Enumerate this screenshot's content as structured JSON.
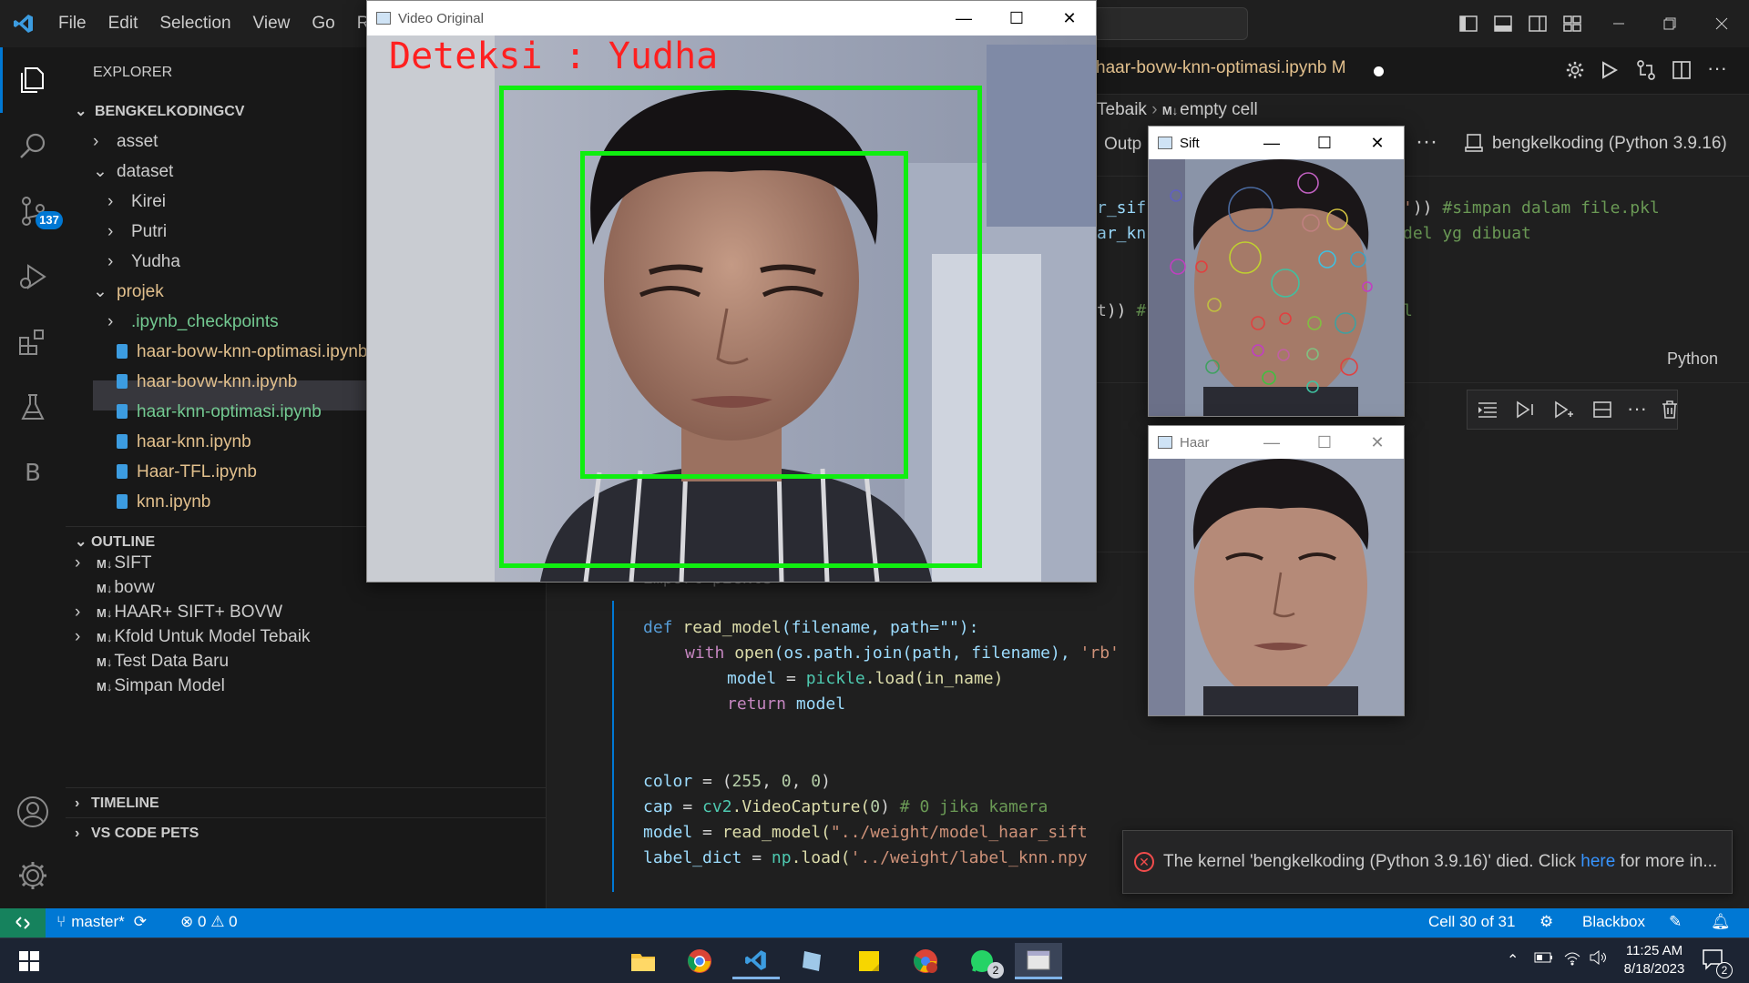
{
  "menu": [
    "File",
    "Edit",
    "Selection",
    "View",
    "Go",
    "R"
  ],
  "explorer": {
    "title": "EXPLORER",
    "root": "BENGKELKODINGCV",
    "items": [
      {
        "label": "asset",
        "type": "folder",
        "collapsed": true,
        "level": 1
      },
      {
        "label": "dataset",
        "type": "folder",
        "collapsed": false,
        "level": 1
      },
      {
        "label": "Kirei",
        "type": "folder",
        "collapsed": true,
        "level": 2
      },
      {
        "label": "Putri",
        "type": "folder",
        "collapsed": true,
        "level": 2
      },
      {
        "label": "Yudha",
        "type": "folder",
        "collapsed": true,
        "level": 2
      },
      {
        "label": "projek",
        "type": "folder",
        "collapsed": false,
        "level": 1,
        "status": "mod"
      },
      {
        "label": ".ipynb_checkpoints",
        "type": "folder",
        "collapsed": true,
        "level": 2,
        "status": "new"
      },
      {
        "label": "haar-bovw-knn-optimasi.ipynb",
        "type": "file",
        "level": 2,
        "status": "mod",
        "selected": true
      },
      {
        "label": "haar-bovw-knn.ipynb",
        "type": "file",
        "level": 2,
        "status": "mod"
      },
      {
        "label": "haar-knn-optimasi.ipynb",
        "type": "file",
        "level": 2,
        "status": "new"
      },
      {
        "label": "haar-knn.ipynb",
        "type": "file",
        "level": 2,
        "status": "mod"
      },
      {
        "label": "Haar-TFL.ipynb",
        "type": "file",
        "level": 2,
        "status": "mod"
      },
      {
        "label": "knn.ipynb",
        "type": "file",
        "level": 2,
        "status": "mod"
      }
    ]
  },
  "outline": {
    "title": "OUTLINE",
    "md_tag": "M↓",
    "items": [
      {
        "label": "SIFT",
        "collapsible": true
      },
      {
        "label": "bovw",
        "collapsible": false
      },
      {
        "label": "HAAR+ SIFT+ BOVW",
        "collapsible": true
      },
      {
        "label": "Kfold Untuk Model Tebaik",
        "collapsible": true
      },
      {
        "label": "Test Data Baru",
        "collapsible": false
      },
      {
        "label": "Simpan Model",
        "collapsible": false
      }
    ]
  },
  "timeline_title": "TIMELINE",
  "pets_title": "VS CODE PETS",
  "badge_count": "137",
  "editor": {
    "tab_label": "haar-bovw-knn-optimasi.ipynb",
    "tab_status": "M",
    "breadcrumb": [
      "Tebaik",
      "empty cell"
    ],
    "breadcrumb_tag": "M↓",
    "outputs_label": "Outp",
    "kernel": "bengkelkoding (Python 3.9.16)",
    "cell_lang": "Python"
  },
  "code_top": {
    "l1a": "r_sif",
    "l1b": ")) ",
    "l1c": "#simpan dalam file.pkl",
    "l2a": "ar_kn",
    "l2b": "del yg dibuat",
    "l3a": "t)) ",
    "l3b": "#",
    "l3c": "l"
  },
  "code_bottom": {
    "partial": "import pickle",
    "def_line": {
      "kw": "def",
      "fn": "read_model",
      "args": "(filename, path=\"\"):"
    },
    "with_line": {
      "kw": "with",
      "fn": "open",
      "mid": "(os.path.join(path, filename), ",
      "str": "'rb'"
    },
    "model_line": {
      "var": "model",
      "op": " = ",
      "mod": "pickle",
      "fn": ".load(in_name)"
    },
    "return_line": {
      "kw": "return",
      "var": " model"
    },
    "color_line": {
      "var": "color",
      "op": " = (",
      "n1": "255",
      "n2": "0",
      "n3": "0"
    },
    "cap_line": {
      "var": "cap",
      "op": " = ",
      "mod": "cv2",
      "fn": ".VideoCapture(",
      "n": "0",
      "cm": "# 0 jika kamera"
    },
    "rm_line": {
      "var": "model",
      "op": " = ",
      "fn": "read_model(",
      "str": "\"../weight/model_haar_sift"
    },
    "ld_line": {
      "var": "label_dict",
      "op": " = ",
      "mod": "np",
      "fn": ".load(",
      "str": "'../weight/label_knn.npy"
    }
  },
  "windows": {
    "video": {
      "title": "Video Original",
      "detect_text": "Deteksi : Yudha"
    },
    "sift": {
      "title": "Sift"
    },
    "haar": {
      "title": "Haar"
    }
  },
  "toast": {
    "text_before": "The kernel 'bengkelkoding (Python 3.9.16)' died. Click ",
    "link": "here",
    "text_after": " for more in..."
  },
  "status": {
    "branch": "master*",
    "errors": "0",
    "warnings": "0",
    "cell": "Cell 30 of 31",
    "blackbox": "Blackbox"
  },
  "clock": {
    "time": "11:25 AM",
    "date": "8/18/2023"
  },
  "notif_count": "2",
  "whatsapp_count": "2",
  "colors": {
    "accent": "#0078d4",
    "detect": "#ff2020",
    "box": "#10ee10",
    "git_mod": "#e2c08d",
    "git_new": "#73c991"
  }
}
